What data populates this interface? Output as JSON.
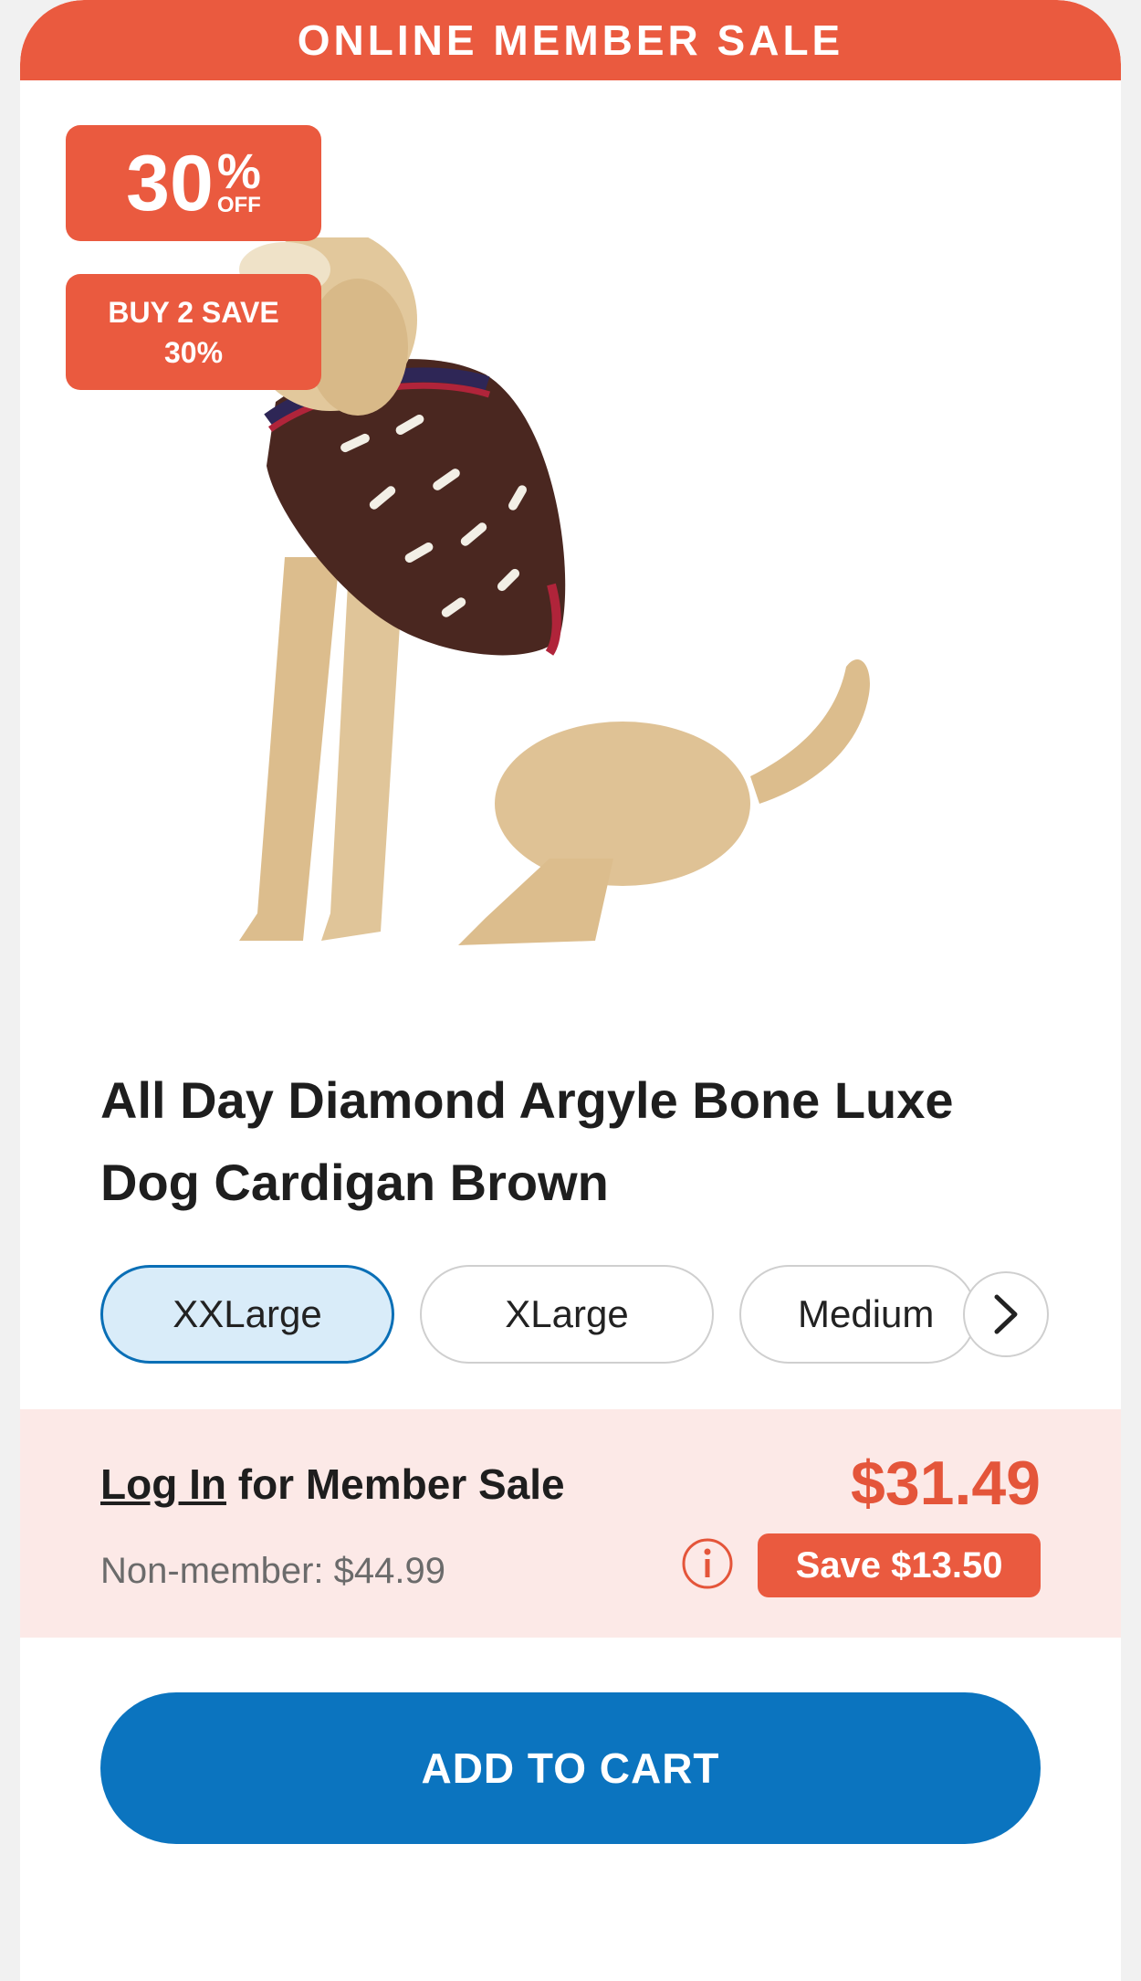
{
  "banner": {
    "text": "ONLINE MEMBER SALE"
  },
  "badges": {
    "discount_number": "30",
    "discount_percent": "%",
    "discount_off": "OFF",
    "bundle": "BUY 2 SAVE 30%"
  },
  "product": {
    "title": "All Day Diamond Argyle Bone Luxe Dog Cardigan Brown",
    "image": "dog-in-brown-bone-cardigan"
  },
  "sizes": {
    "options": [
      {
        "label": "XXLarge",
        "selected": true
      },
      {
        "label": "XLarge",
        "selected": false
      },
      {
        "label": "Medium",
        "selected": false
      }
    ],
    "next_icon": "chevron-right-icon"
  },
  "pricing": {
    "login_link": "Log In",
    "login_suffix": "for Member Sale",
    "non_member": "Non-member: $44.99",
    "member_price": "$31.49",
    "save": "Save $13.50",
    "info_icon": "info-icon"
  },
  "cart": {
    "label": "ADD TO CART"
  },
  "colors": {
    "sale_red": "#ea5a3f",
    "price_red": "#e4553a",
    "cart_blue": "#0b74bf",
    "selected_chip_bg": "#d9ecf9",
    "panel_bg": "#fce9e7"
  }
}
